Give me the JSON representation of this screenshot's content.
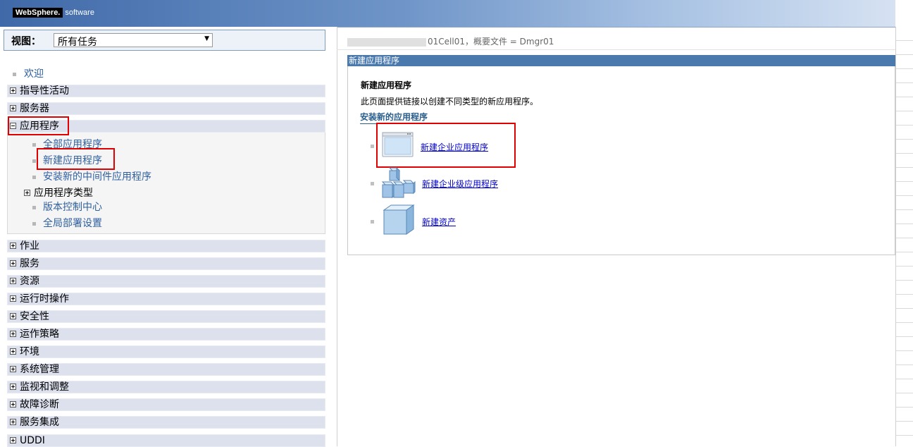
{
  "header": {
    "logo_brand": "WebSphere.",
    "logo_suffix": "software"
  },
  "nav": {
    "view_label": "视图：",
    "view_value": "所有任务",
    "welcome": "欢迎",
    "cat_guided": "指导性活动",
    "cat_servers": "服务器",
    "cat_apps": "应用程序",
    "apps_children": {
      "all": "全部应用程序",
      "new": "新建应用程序",
      "middleware": "安装新的中间件应用程序",
      "types": "应用程序类型",
      "edition": "版本控制中心",
      "global": "全局部署设置"
    },
    "cat_jobs": "作业",
    "cat_services": "服务",
    "cat_resources": "资源",
    "cat_runtime": "运行时操作",
    "cat_security": "安全性",
    "cat_opspolicy": "运作策略",
    "cat_env": "环境",
    "cat_sysadmin": "系统管理",
    "cat_monitor": "监视和调整",
    "cat_trouble": "故障诊断",
    "cat_integration": "服务集成",
    "cat_uddi": "UDDI"
  },
  "main": {
    "breadcrumb_suffix": "01Cell01，概要文件 = Dmgr01",
    "panel_title": "新建应用程序",
    "heading": "新建应用程序",
    "description": "此页面提供链接以创建不同类型的新应用程序。",
    "section_title": "安装新的应用程序",
    "links": {
      "enterprise": "新建企业应用程序",
      "business": "新建企业级应用程序",
      "asset": "新建资产"
    }
  },
  "colors": {
    "banner": "#3f69a8",
    "panel_title": "#4a79ad",
    "highlight": "#e00000",
    "link": "#0000cc"
  }
}
